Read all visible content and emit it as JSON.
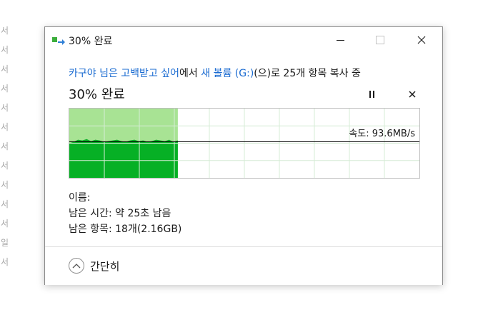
{
  "background": {
    "side_glyphs": [
      "서",
      "서",
      "서",
      "서",
      "서",
      "서",
      "서",
      "서",
      "서",
      "서",
      "서",
      "일",
      "서"
    ]
  },
  "window": {
    "title": "30% 완료",
    "icon": "file-copy-icon",
    "controls": {
      "minimize": "minimize-icon",
      "maximize": "maximize-icon",
      "close": "close-icon"
    }
  },
  "status": {
    "prefix": "",
    "source": "카구야 님은 고백받고 싶어",
    "middle": "에서 ",
    "destination": "새 볼륨 (G:)",
    "suffix": "(으)로 25개 항목 복사 중"
  },
  "progress": {
    "title": "30% 완료",
    "percent": 30,
    "pause_icon": "pause-icon",
    "cancel_icon": "close-icon"
  },
  "graph": {
    "speed_label": "속도: 93.6MB/s",
    "fill_fraction": 0.31,
    "current_speed_fraction": 0.52,
    "history_fractions": [
      0.5,
      0.52,
      0.55,
      0.54,
      0.56,
      0.53,
      0.55,
      0.54,
      0.52,
      0.53,
      0.54,
      0.55,
      0.53,
      0.52,
      0.54,
      0.55,
      0.53,
      0.54,
      0.52,
      0.53,
      0.55,
      0.54,
      0.53,
      0.55,
      0.52,
      0.54
    ],
    "colors": {
      "done_area": "#a8e394",
      "speed_area": "#06b025",
      "grid": "#d6ecd6",
      "speed_line": "#000000"
    }
  },
  "info": {
    "name_label": "이름:",
    "name_value": "",
    "time_label": "남은 시간:",
    "time_value": "약 25초 남음",
    "items_label": "남은 항목:",
    "items_value": "18개(2.16GB)"
  },
  "footer": {
    "toggle_label": "간단히",
    "toggle_icon": "chevron-up-icon"
  }
}
